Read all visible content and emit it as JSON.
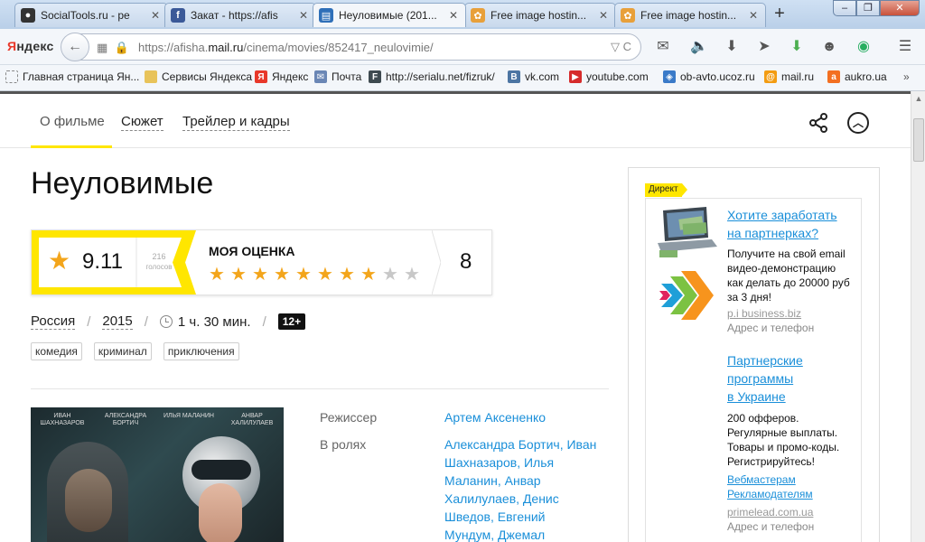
{
  "browser": {
    "tabs": [
      {
        "title": "SocialTools.ru - ре",
        "icon": "socialtools-icon",
        "color": "#333333",
        "active": false
      },
      {
        "title": "Закат - https://afis",
        "icon": "facebook-icon",
        "color": "#3b5998",
        "active": false
      },
      {
        "title": "Неуловимые (201...",
        "icon": "afisha-icon",
        "color": "#2e6fb8",
        "active": true
      },
      {
        "title": "Free image hostin...",
        "icon": "imagehost-icon",
        "color": "#e8a03a",
        "active": false
      },
      {
        "title": "Free image hostin...",
        "icon": "imagehost-icon",
        "color": "#e8a03a",
        "active": false
      }
    ],
    "new_tab": "+",
    "window_buttons": {
      "minimize": "–",
      "maximize": "❐",
      "close": "✕"
    },
    "logo": {
      "prefix": "Я",
      "rest": "ндекс"
    },
    "back": "←",
    "url_prefix": "https://afisha.",
    "url_domain": "mail.ru",
    "url_path": "/cinema/movies/852417_neulovimie/",
    "url_right": "▽ C",
    "bookmarks": [
      {
        "label": "Главная страница Ян...",
        "icon": "page-icon",
        "color": "#888888"
      },
      {
        "label": "Сервисы Яндекса",
        "icon": "folder-icon",
        "color": "#e8c35a"
      },
      {
        "label": "Яндекс",
        "icon": "yandex-icon",
        "color": "#e8382a"
      },
      {
        "label": "Почта",
        "icon": "mail-icon",
        "color": "#6a86b5"
      },
      {
        "label": "http://serialu.net/fizruk/",
        "icon": "serialu-icon",
        "color": "#3e4a50"
      },
      {
        "label": "vk.com",
        "icon": "vk-icon",
        "color": "#4c75a3"
      },
      {
        "label": "youtube.com",
        "icon": "youtube-icon",
        "color": "#d62b2b"
      },
      {
        "label": "ob-avto.ucoz.ru",
        "icon": "ucoz-icon",
        "color": "#3a7ac8"
      },
      {
        "label": "mail.ru",
        "icon": "mailru-icon",
        "color": "#f39c12"
      },
      {
        "label": "aukro.ua",
        "icon": "aukro-icon",
        "color": "#f36f21"
      }
    ]
  },
  "subnav": {
    "tabs": [
      "О фильме",
      "Сюжет",
      "Трейлер и кадры"
    ]
  },
  "movie": {
    "title": "Неуловимые",
    "rating": "9.11",
    "votes_count": "216",
    "votes_label": "голосов",
    "my_rating_label": "МОЯ ОЦЕНКА",
    "stars_total": 10,
    "stars_filled": 8,
    "my_rating": "8",
    "country": "Россия",
    "year": "2015",
    "duration": "1 ч. 30 мин.",
    "age": "12+",
    "genres": [
      "комедия",
      "криминал",
      "приключения"
    ],
    "poster_names": [
      "ИВАН ШАХНАЗАРОВ",
      "АЛЕКСАНДРА БОРТИЧ",
      "ИЛЬЯ МАЛАНИН",
      "АНВАР ХАЛИЛУЛАЕВ"
    ],
    "director_label": "Режиссер",
    "director": "Артем Аксененко",
    "cast_label": "В ролях",
    "cast_lines": [
      "Александра Бортич, Иван",
      "Шахназаров, Илья",
      "Маланин, Анвар",
      "Халилулаев, Денис",
      "Шведов, Евгений",
      "Мундум, Джемал"
    ]
  },
  "ads": {
    "tag": "Директ",
    "ad1": {
      "title_lines": [
        "Хотите заработать",
        "на партнерках?"
      ],
      "text_lines": [
        "Получите на свой email",
        "видео-демонстрацию",
        "как делать до 20000 руб",
        "за 3 дня!"
      ],
      "domain": "p.i business.biz",
      "address": "Адрес и телефон"
    },
    "ad2": {
      "title_lines": [
        "Партнерские",
        "программы",
        "в Украине"
      ],
      "text_lines": [
        "200 офферов.",
        "Регулярные выплаты.",
        "Товары и промо-коды.",
        "Регистрируйтесь!"
      ],
      "links": [
        "Вебмастерам",
        "Рекламодателям"
      ],
      "domain": "primelead.com.ua",
      "address": "Адрес и телефон"
    }
  },
  "colors": {
    "accent_yellow": "#ffe600",
    "link_blue": "#1a8fd9",
    "star_orange": "#f3a51b"
  }
}
